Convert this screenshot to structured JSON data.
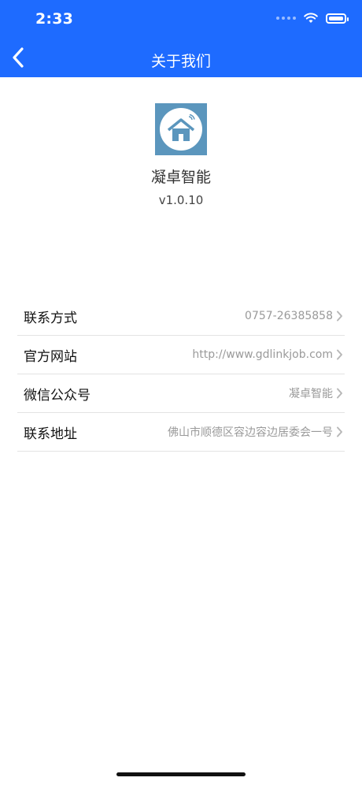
{
  "status_bar": {
    "time": "2:33"
  },
  "nav": {
    "title": "关于我们"
  },
  "app": {
    "name": "凝卓智能",
    "version": "v1.0.10"
  },
  "info_rows": [
    {
      "label": "联系方式",
      "value": "0757-26385858"
    },
    {
      "label": "官方网站",
      "value": "http://www.gdlinkjob.com"
    },
    {
      "label": "微信公众号",
      "value": "凝卓智能"
    },
    {
      "label": "联系地址",
      "value": "佛山市顺德区容边容边居委会一号"
    }
  ],
  "colors": {
    "header": "#1e6bff",
    "logo_bg": "#5b96bd",
    "value_text": "#9a9a9a"
  },
  "icons": [
    "back-arrow-icon",
    "wifi-icon",
    "battery-icon",
    "house-logo-icon",
    "chevron-right-icon"
  ]
}
